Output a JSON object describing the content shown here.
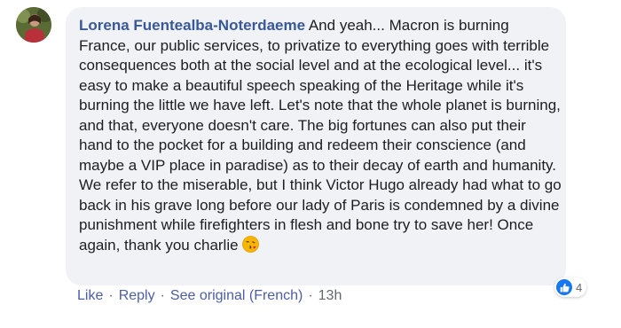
{
  "comment": {
    "author": "Lorena Fuentealba-Noterdaeme",
    "text_first": " And yeah... Macron is burning France, our public services, to privatize to everything goes with terrible consequences both at the social level and at the ecological level... it's easy to make a beautiful speech speaking of the Heritage while it's burning the little we have left. Let's note that the whole planet is burning, and that, everyone doesn't care. The big fortunes can also put their hand to the pocket for a building and redeem their conscience (and maybe a VIP place in paradise) as to their decay of earth and humanity.\nWe refer to the miserable, but I think Victor Hugo already had what to go back in his grave long before our lady of Paris is condemned by a divine punishment while firefighters in flesh and bone try to save her! Once again, thank you charlie",
    "emoji": "kissing-face-emoji"
  },
  "reactions": {
    "icon": "like-icon",
    "count": "4"
  },
  "actions": {
    "like": "Like",
    "reply": "Reply",
    "see_original": "See original (French)",
    "separator": "·",
    "time": "13h"
  },
  "colors": {
    "author": "#385898",
    "bubble": "#f0f2f5",
    "link": "#4b5ea6",
    "like_badge": "#1877f2"
  }
}
